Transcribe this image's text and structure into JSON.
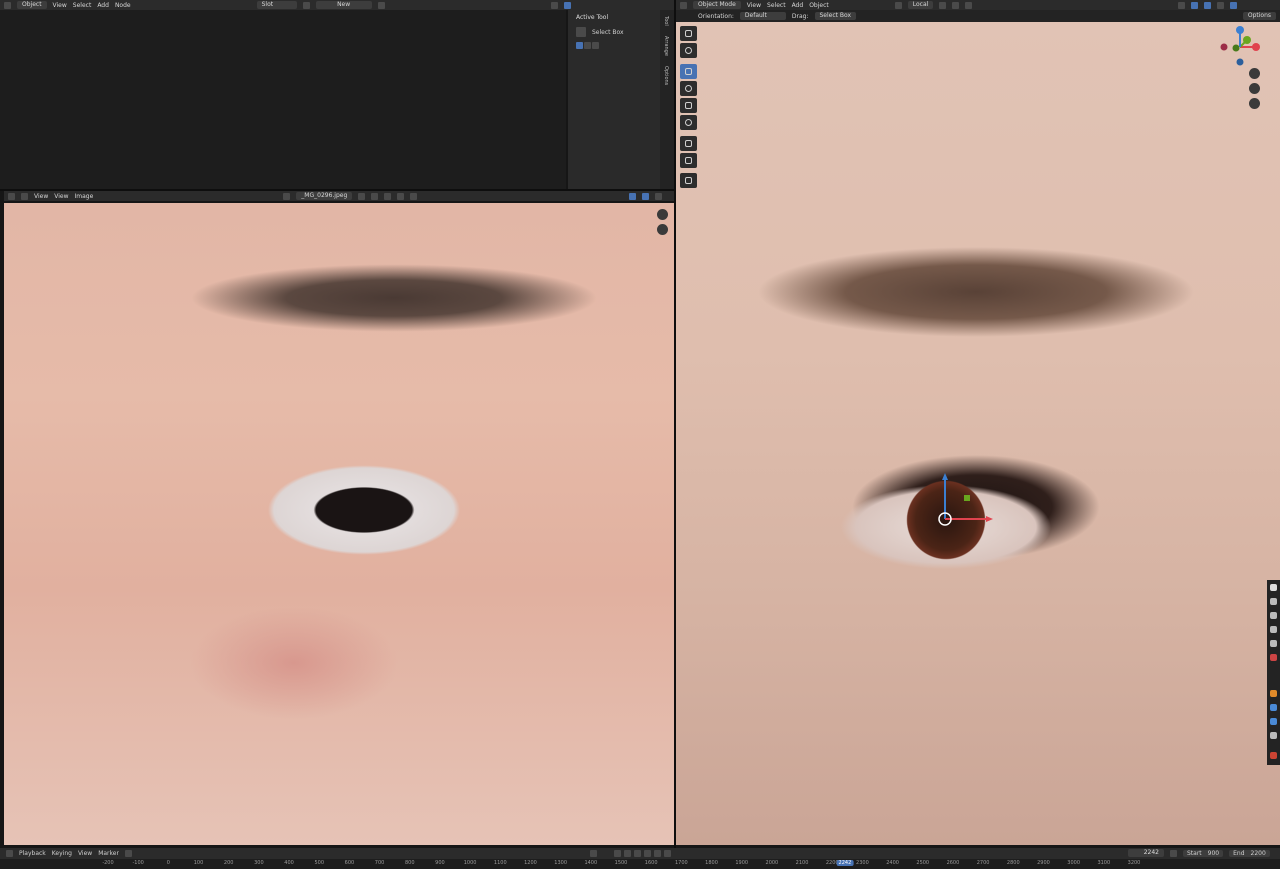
{
  "top_header": {
    "mode": "Object",
    "menus": [
      "View",
      "Select",
      "Add",
      "Node"
    ],
    "slot": "Slot",
    "new_label": "New"
  },
  "active_tool_panel": {
    "section": "Active Tool",
    "tool_name": "Select Box",
    "tabs": [
      "Tool",
      "Arrange",
      "Options"
    ]
  },
  "image_editor": {
    "menus": [
      "View",
      "View",
      "Image"
    ],
    "filename": "_MG_0296.jpeg"
  },
  "viewport_header": {
    "mode": "Object Mode",
    "menus": [
      "View",
      "Select",
      "Add",
      "Object"
    ],
    "transform": "Local",
    "options_label": "Options"
  },
  "viewport_subheader": {
    "orientation_label": "Orientation:",
    "orientation_value": "Default",
    "drag_label": "Drag:",
    "drag_value": "Select Box"
  },
  "timeline": {
    "menus": [
      "Playback",
      "Keying",
      "View",
      "Marker"
    ],
    "current_frame": "2242",
    "start_label": "Start",
    "start_value": "900",
    "end_label": "End",
    "end_value": "2200",
    "ruler_ticks": [
      "-200",
      "-100",
      "0",
      "100",
      "200",
      "300",
      "400",
      "500",
      "600",
      "700",
      "800",
      "900",
      "1000",
      "1100",
      "1200",
      "1300",
      "1400",
      "1500",
      "1600",
      "1700",
      "1800",
      "1900",
      "2000",
      "2100",
      "2200",
      "2242",
      "2300",
      "2400",
      "2500",
      "2600",
      "2700",
      "2800",
      "2900",
      "3000",
      "3100",
      "3200"
    ]
  },
  "colors": {
    "accent": "#4772b3",
    "header_bg": "#2b2b2b",
    "panel_bg": "#1d1d1d",
    "gizmo_x": "#e0434e",
    "gizmo_y": "#6aa61f",
    "gizmo_z": "#3b7fd1"
  },
  "icons": [
    "select-icon",
    "cursor-icon",
    "move-icon",
    "rotate-icon",
    "scale-icon",
    "transform-icon",
    "annotate-icon",
    "measure-icon",
    "add-cube-icon"
  ]
}
